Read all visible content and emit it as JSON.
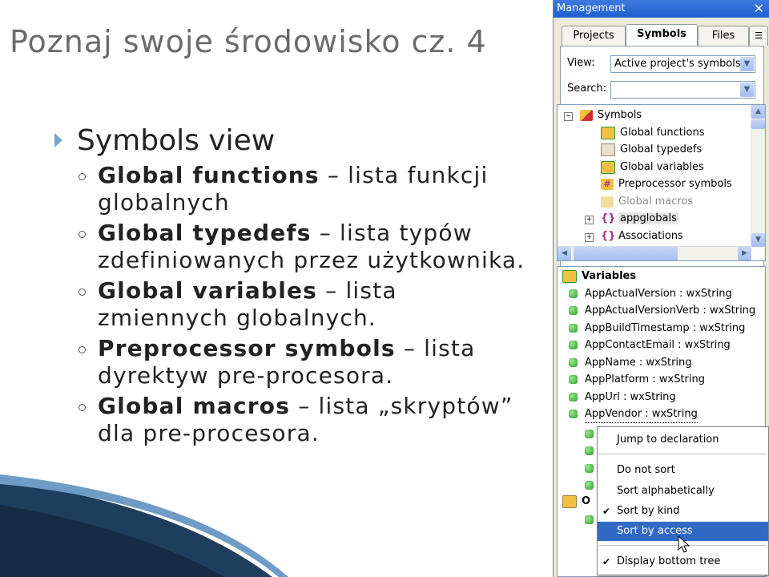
{
  "slide": {
    "title": "Poznaj swoje środowisko cz. 4",
    "bullet": "Symbols view",
    "items": [
      {
        "term": "Global functions",
        "desc": " – lista funkcji globalnych"
      },
      {
        "term": "Global typedefs",
        "desc": " – lista typów zdefiniowanych przez użytkownika."
      },
      {
        "term": "Global variables",
        "desc": " – lista zmiennych globalnych."
      },
      {
        "term": "Preprocessor symbols",
        "desc": " – lista dyrektyw pre-procesora."
      },
      {
        "term": "Global macros",
        "desc": " – lista „skryptów” dla pre-procesora."
      }
    ]
  },
  "panel": {
    "title": "Management",
    "tabs": [
      "Projects",
      "Symbols",
      "Files"
    ],
    "view_label": "View:",
    "view_value": "Active project's symbols",
    "search_label": "Search:",
    "search_value": "",
    "tree": [
      {
        "label": "Symbols"
      },
      {
        "label": "Global functions"
      },
      {
        "label": "Global typedefs"
      },
      {
        "label": "Global variables"
      },
      {
        "label": "Preprocessor symbols"
      },
      {
        "label": "Global macros"
      },
      {
        "label": "appglobals"
      },
      {
        "label": "Associations"
      }
    ],
    "variables_title": "Variables",
    "variables": [
      "AppActualVersion : wxString",
      "AppActualVersionVerb : wxString",
      "AppBuildTimestamp : wxString",
      "AppContactEmail : wxString",
      "AppName : wxString",
      "AppPlatform : wxString",
      "AppUrl : wxString",
      "AppVendor : wxString"
    ],
    "other_label": "O"
  },
  "context_menu": {
    "items": [
      {
        "label": "Jump to declaration",
        "checked": false,
        "highlighted": false
      },
      {
        "label": "Do not sort",
        "checked": false,
        "highlighted": false
      },
      {
        "label": "Sort alphabetically",
        "checked": false,
        "highlighted": false
      },
      {
        "label": "Sort by kind",
        "checked": true,
        "highlighted": false
      },
      {
        "label": "Sort by access",
        "checked": false,
        "highlighted": true
      },
      {
        "label": "Display bottom tree",
        "checked": true,
        "highlighted": false
      }
    ]
  }
}
